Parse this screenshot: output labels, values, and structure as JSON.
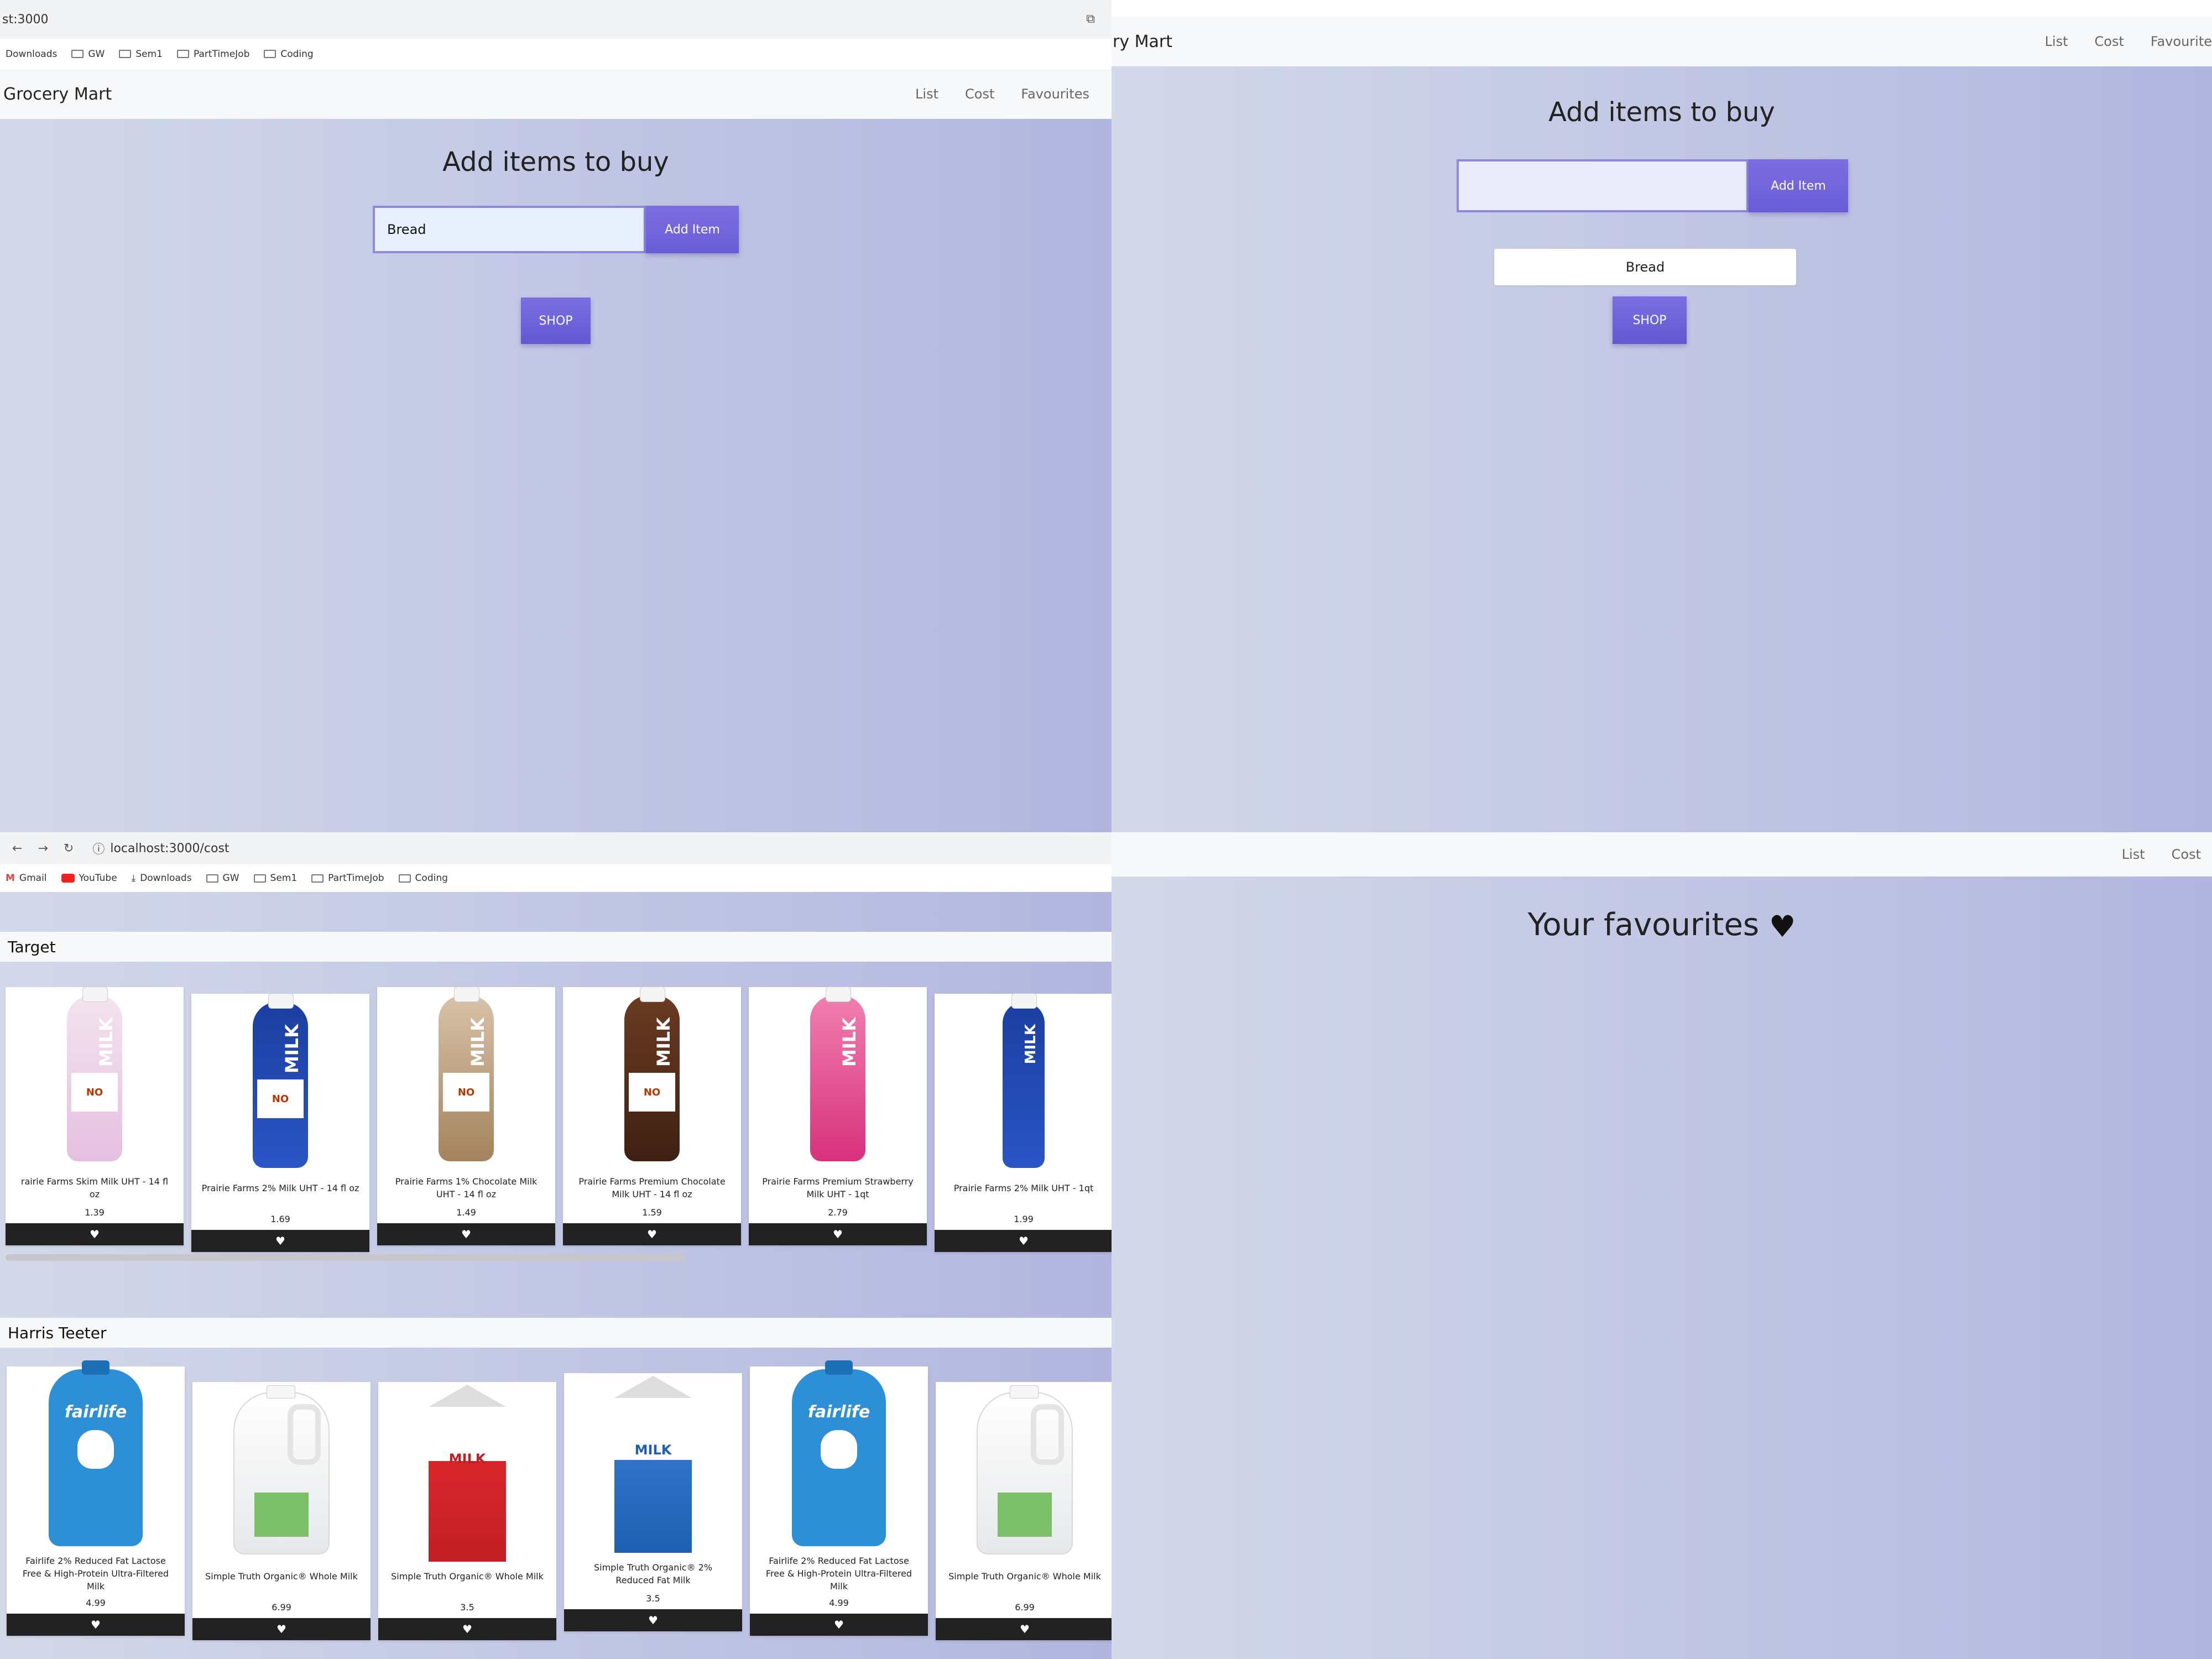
{
  "panel1": {
    "url": "st:3000",
    "bookmarks": [
      "Downloads",
      "GW",
      "Sem1",
      "PartTimeJob",
      "Coding"
    ],
    "brand": "Grocery Mart",
    "nav": [
      "List",
      "Cost",
      "Favourites"
    ],
    "heading": "Add items to buy",
    "input_value": "Bread",
    "add_button": "Add Item",
    "shop_button": "SHOP"
  },
  "panel2": {
    "brand": "ry Mart",
    "nav": [
      "List",
      "Cost",
      "Favourite"
    ],
    "heading": "Add items to buy",
    "input_value": "",
    "add_button": "Add Item",
    "list_item": "Bread",
    "shop_button": "SHOP"
  },
  "panel3": {
    "url": "localhost:3000/cost",
    "bookmarks": [
      "Gmail",
      "YouTube",
      "Downloads",
      "GW",
      "Sem1",
      "PartTimeJob",
      "Coding"
    ],
    "stores": [
      {
        "name": "Target",
        "products": [
          {
            "name": "rairie Farms Skim Milk UHT - 14 fl oz",
            "price": "1.39",
            "image": "milk-bottle-pink"
          },
          {
            "name": "Prairie Farms 2% Milk UHT - 14 fl oz",
            "price": "1.69",
            "image": "milk-bottle-blue"
          },
          {
            "name": "Prairie Farms 1% Chocolate Milk UHT - 14 fl oz",
            "price": "1.49",
            "image": "milk-bottle-tan"
          },
          {
            "name": "Prairie Farms Premium Chocolate Milk UHT - 14 fl oz",
            "price": "1.59",
            "image": "milk-bottle-brown"
          },
          {
            "name": "Prairie Farms Premium Strawberry Milk UHT - 1qt",
            "price": "2.79",
            "image": "milk-bottle-magenta"
          },
          {
            "name": "Prairie Farms 2% Milk UHT - 1qt",
            "price": "1.99",
            "image": "milk-bottle-blue"
          }
        ]
      },
      {
        "name": "Harris Teeter",
        "products": [
          {
            "name": "Fairlife 2% Reduced Fat Lactose Free & High-Protein Ultra-Filtered Milk",
            "price": "4.99",
            "image": "fairlife-bottle"
          },
          {
            "name": "Simple Truth Organic® Whole Milk",
            "price": "6.99",
            "image": "milk-jug"
          },
          {
            "name": "Simple Truth Organic® Whole Milk",
            "price": "3.5",
            "image": "milk-carton-red"
          },
          {
            "name": "Simple Truth Organic® 2% Reduced Fat Milk",
            "price": "3.5",
            "image": "milk-carton-blue"
          },
          {
            "name": "Fairlife 2% Reduced Fat Lactose Free & High-Protein Ultra-Filtered Milk",
            "price": "4.99",
            "image": "fairlife-bottle"
          },
          {
            "name": "Simple Truth Organic® Whole Milk",
            "price": "6.99",
            "image": "milk-jug"
          }
        ]
      }
    ],
    "fav_icon": "heart-icon"
  },
  "panel4": {
    "nav": [
      "List",
      "Cost"
    ],
    "heading": "Your favourites",
    "heading_icon": "heart-icon"
  },
  "colors": {
    "accent": "#6a5cd6",
    "gradient_start": "#d3d9e8",
    "gradient_end": "#b2b6df",
    "fav_bar": "#222222"
  }
}
